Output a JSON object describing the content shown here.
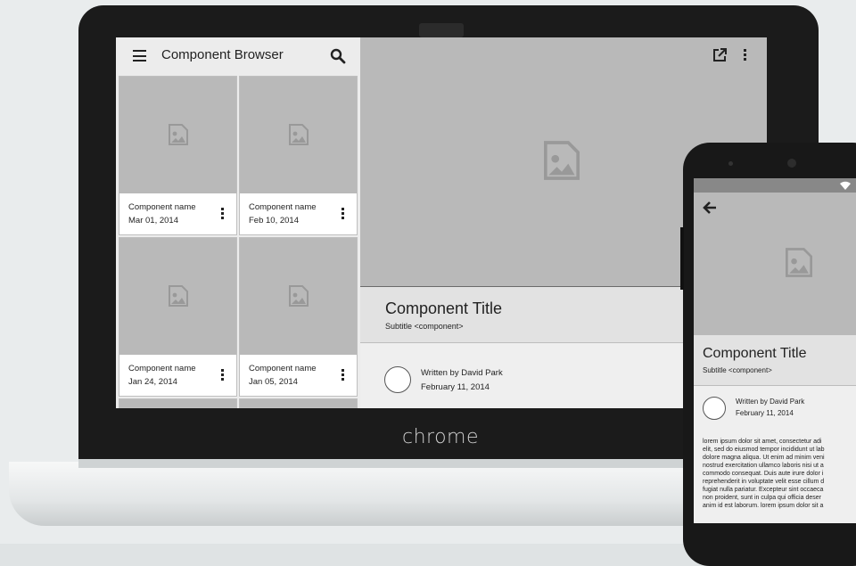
{
  "device": {
    "brand": "chrome"
  },
  "app": {
    "title": "Component Browser",
    "cards": [
      {
        "name": "Component name",
        "date": "Mar 01, 2014"
      },
      {
        "name": "Component name",
        "date": "Feb 10, 2014"
      },
      {
        "name": "Component name",
        "date": "Jan 24, 2014"
      },
      {
        "name": "Component name",
        "date": "Jan 05, 2014"
      }
    ]
  },
  "detail": {
    "title": "Component Title",
    "subtitle": "Subtitle <component>",
    "author": "Written by David Park",
    "date": "February 11, 2014"
  },
  "phone": {
    "title": "Component Title",
    "subtitle": "Subtitle <component>",
    "author": "Written by David Park",
    "date": "February 11, 2014",
    "body": "lorem ipsum dolor sit amet, consectetur adi\nelit, sed do eiusmod tempor incididunt ut lab\ndolore magna aliqua. Ut enim ad minim veni\nnostrud exercitation ullamco laboris nisi ut a\ncommodo consequat. Duis aute irure dolor i\nreprehenderit in voluptate velit esse cillum d\nfugiat nulla pariatur. Excepteur sint occaeca\nnon proident, sunt in culpa qui officia deser\nanim id est laborum. lorem ipsum dolor sit a"
  },
  "icons": [
    "menu-icon",
    "search-icon",
    "image-placeholder-icon",
    "more-vert-icon",
    "open-in-new-icon",
    "arrow-back-icon",
    "wifi-icon"
  ]
}
